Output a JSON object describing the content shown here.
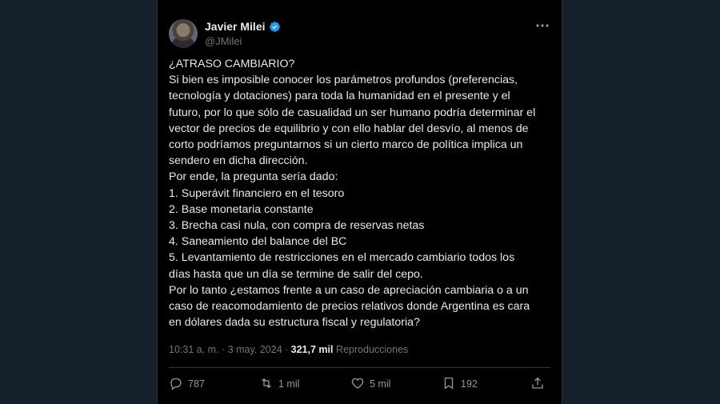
{
  "author": {
    "display_name": "Javier Milei",
    "handle": "@JMilei",
    "verified": true
  },
  "tweet": {
    "lines": [
      "¿ATRASO CAMBIARIO?",
      "Si bien es imposible conocer los parámetros profundos (preferencias,",
      "tecnología y dotaciones) para toda la humanidad en el presente y el",
      "futuro, por lo que sólo de casualidad un ser humano podría determinar el",
      "vector de precios de equilibrio y con ello hablar del desvío, al menos de",
      "corto podríamos preguntarnos si un cierto marco de política implica un",
      "sendero en dicha dirección.",
      "Por ende, la pregunta sería dado:",
      "1. Superávit financiero en el tesoro",
      "2. Base monetaria constante",
      "3. Brecha casi nula, con compra de reservas netas",
      "4. Saneamiento del balance del BC",
      "5. Levantamiento de restricciones en el mercado cambiario todos los",
      "días hasta que un día se termine de salir del cepo.",
      "Por lo tanto ¿estamos frente a un caso de apreciación cambiaria o a un",
      "caso de reacomodamiento de precios relativos donde Argentina es cara",
      "en dólares dada su estructura fiscal y regulatoria?"
    ]
  },
  "meta": {
    "time": "10:31 a. m.",
    "separator": " · ",
    "date": "3 may. 2024",
    "views_count": "321,7 mil",
    "views_label": "Reproducciones"
  },
  "actions": {
    "replies": "787",
    "retweets": "1 mil",
    "likes": "5 mil",
    "bookmarks": "192"
  },
  "colors": {
    "page_bg": "#15202b",
    "column_bg": "#000000",
    "text": "#e7e9ea",
    "muted": "#71767b",
    "verified": "#1d9bf0"
  }
}
